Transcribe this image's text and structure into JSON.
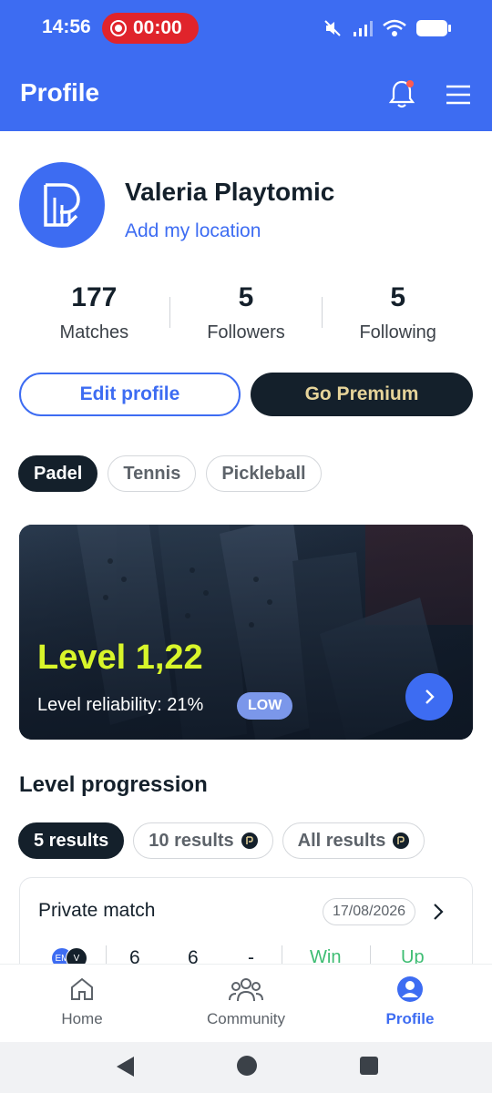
{
  "status_bar": {
    "time": "14:56",
    "recording_time": "00:00"
  },
  "header": {
    "title": "Profile",
    "icons": [
      "bell-icon",
      "menu-icon"
    ]
  },
  "profile": {
    "name": "Valeria Playtomic",
    "location_link": "Add my location",
    "stats": [
      {
        "value": "177",
        "label": "Matches"
      },
      {
        "value": "5",
        "label": "Followers"
      },
      {
        "value": "5",
        "label": "Following"
      }
    ],
    "edit_button": "Edit profile",
    "premium_button": "Go Premium"
  },
  "sports": {
    "tabs": [
      "Padel",
      "Tennis",
      "Pickleball"
    ],
    "selected": "Padel"
  },
  "level_card": {
    "level": "Level 1,22",
    "reliability": "Level reliability: 21%",
    "badge": "LOW"
  },
  "progression": {
    "title": "Level progression",
    "tabs": [
      "5 results",
      "10 results",
      "All results"
    ],
    "selected": "5 results"
  },
  "match": {
    "title": "Private match",
    "date": "17/08/2026",
    "avatars": [
      "EM",
      "V"
    ],
    "scores": [
      "6",
      "6",
      "-"
    ],
    "result": "Win",
    "trend": "Up"
  },
  "bottom_nav": {
    "items": [
      {
        "label": "Home",
        "icon": "home-icon"
      },
      {
        "label": "Community",
        "icon": "community-icon"
      },
      {
        "label": "Profile",
        "icon": "profile-icon"
      }
    ],
    "active": "Profile"
  },
  "colors": {
    "brand": "#3d6cf2",
    "dark": "#14202b",
    "level": "#d8f52a",
    "win": "#3ebd73"
  }
}
